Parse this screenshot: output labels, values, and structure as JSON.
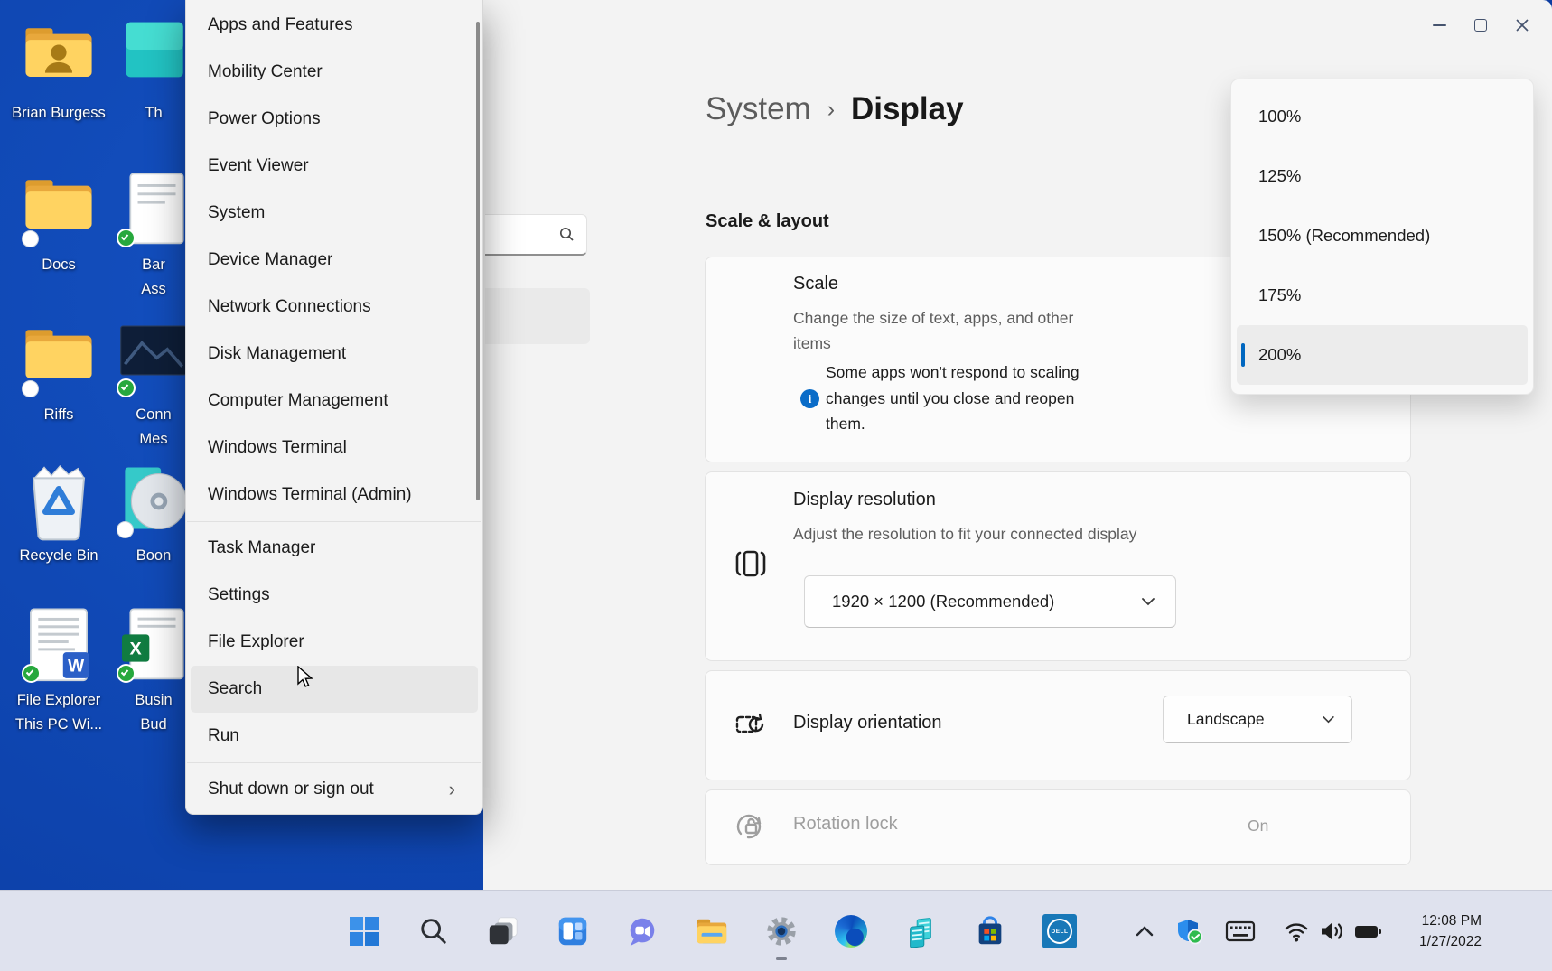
{
  "desktop": {
    "icons": [
      {
        "label": "Brian Burgess"
      },
      {
        "label": "Docs"
      },
      {
        "label": "Riffs"
      },
      {
        "label": "Recycle Bin"
      },
      {
        "label": "File Explorer\nThis PC Wi..."
      },
      {
        "label": "Th"
      },
      {
        "label": "Bar\nAss"
      },
      {
        "label": "Conn\nMes"
      },
      {
        "label": "Boon"
      },
      {
        "label": "Busin\nBud"
      }
    ]
  },
  "winx_menu": {
    "items": [
      {
        "label": "Apps and Features"
      },
      {
        "label": "Mobility Center"
      },
      {
        "label": "Power Options"
      },
      {
        "label": "Event Viewer"
      },
      {
        "label": "System"
      },
      {
        "label": "Device Manager"
      },
      {
        "label": "Network Connections"
      },
      {
        "label": "Disk Management"
      },
      {
        "label": "Computer Management"
      },
      {
        "label": "Windows Terminal"
      },
      {
        "label": "Windows Terminal (Admin)"
      },
      {
        "label": "Task Manager"
      },
      {
        "label": "Settings"
      },
      {
        "label": "File Explorer"
      },
      {
        "label": "Search"
      },
      {
        "label": "Run"
      },
      {
        "label": "Shut down or sign out"
      }
    ],
    "submenu_chevron": "›"
  },
  "settings": {
    "breadcrumb": {
      "parent": "System",
      "separator": "›",
      "current": "Display"
    },
    "section_title": "Scale & layout",
    "scale_card": {
      "title": "Scale",
      "description": "Change the size of text, apps, and other\nitems",
      "note": "Some apps won't respond to scaling\nchanges until you close and reopen\nthem.",
      "info_glyph": "i"
    },
    "scale_flyout": {
      "options": [
        "100%",
        "125%",
        "150% (Recommended)",
        "175%",
        "200%"
      ],
      "selected": "200%"
    },
    "resolution_card": {
      "title": "Display resolution",
      "description": "Adjust the resolution to fit your connected display",
      "value": "1920 × 1200 (Recommended)"
    },
    "orientation_card": {
      "title": "Display orientation",
      "value": "Landscape"
    },
    "rotation_card": {
      "title": "Rotation lock",
      "state": "On"
    }
  },
  "taskbar": {
    "clock": {
      "time": "12:08 PM",
      "date": "1/27/2022"
    }
  }
}
